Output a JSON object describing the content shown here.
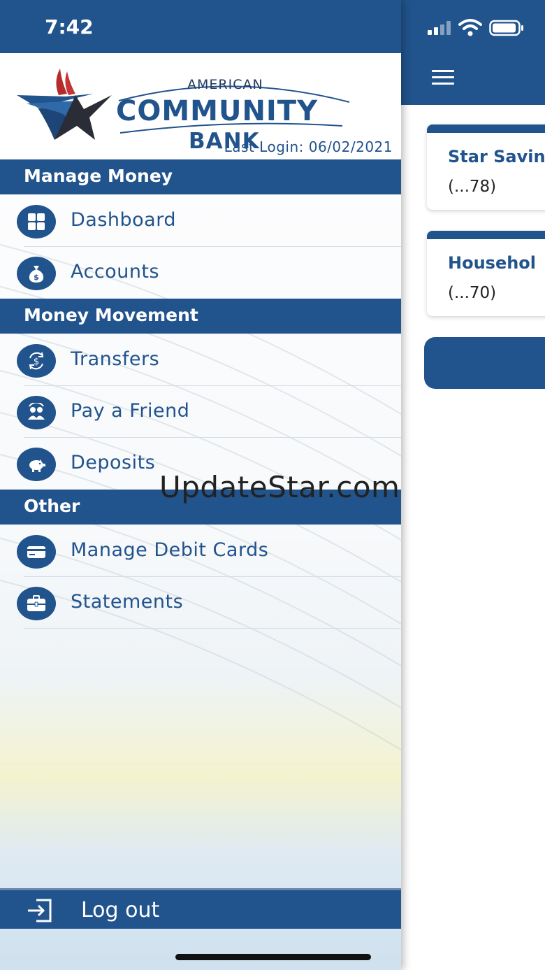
{
  "status_bar": {
    "time": "7:42"
  },
  "brand": {
    "line1": "AMERICAN",
    "line2": "COMMUNITY",
    "line3": "BANK",
    "last_login": "Last Login:  06/02/2021"
  },
  "menu": {
    "sections": [
      {
        "title": "Manage Money",
        "items": [
          "Dashboard",
          "Accounts"
        ]
      },
      {
        "title": "Money Movement",
        "items": [
          "Transfers",
          "Pay a Friend",
          "Deposits"
        ]
      },
      {
        "title": "Other",
        "items": [
          "Manage Debit Cards",
          "Statements"
        ]
      }
    ],
    "logout": "Log out"
  },
  "accounts": [
    {
      "name": "Star Savin",
      "number": "(...78)"
    },
    {
      "name": "Househol",
      "number": "(...70)"
    }
  ],
  "watermark": "UpdateStar.com",
  "colors": {
    "primary": "#21538c",
    "accent_red": "#b52a2a",
    "star_dark": "#2a2d36"
  }
}
